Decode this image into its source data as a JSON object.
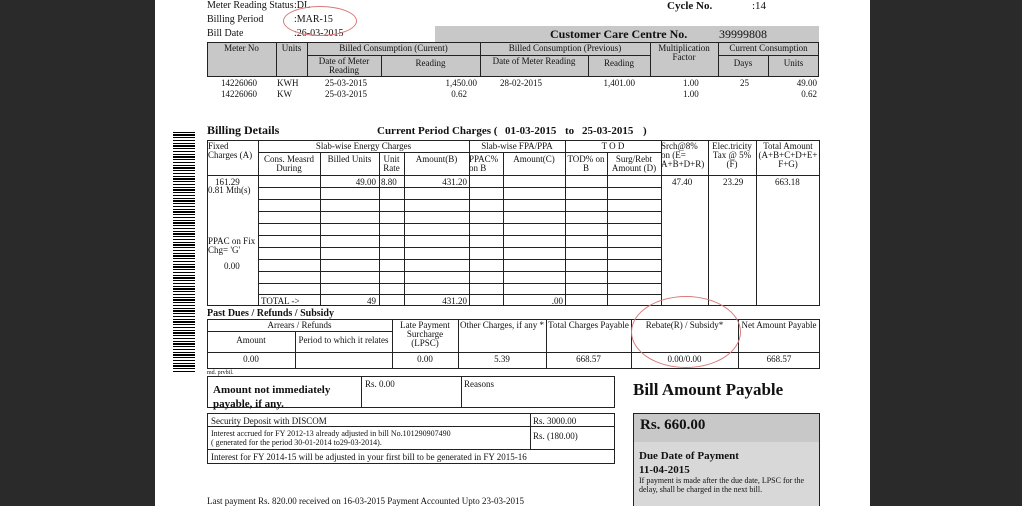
{
  "header": {
    "meter_reading_status_label": "Meter Reading Status",
    "meter_reading_status_value": ":DL",
    "billing_period_label": "Billing Period",
    "billing_period_value": ":MAR-15",
    "bill_date_label": "Bill Date",
    "bill_date_value": ":26-03-2015",
    "cycle_no_label": "Cycle No.",
    "cycle_no_value": ":14",
    "customer_care_label": "Customer Care Centre No.",
    "customer_care_value": "39999808"
  },
  "meter_table": {
    "headers": {
      "meter_no": "Meter No",
      "units": "Units",
      "billed_current": "Billed Consumption (Current)",
      "billed_previous": "Billed Consumption (Previous)",
      "multiplication_factor": "Multiplication Factor",
      "current_consumption": "Current Consumption",
      "date_of_meter_reading": "Date of Meter Reading",
      "reading": "Reading",
      "days": "Days",
      "units_sub": "Units"
    },
    "rows": [
      {
        "meter_no": "14226060",
        "units": "KWH",
        "cur_date": "25-03-2015",
        "cur_reading": "1,450.00",
        "prev_date": "28-02-2015",
        "prev_reading": "1,401.00",
        "mf": "1.00",
        "days": "25",
        "cons_units": "49.00"
      },
      {
        "meter_no": "14226060",
        "units": "KW",
        "cur_date": "25-03-2015",
        "cur_reading": "0.62",
        "prev_date": "",
        "prev_reading": "",
        "mf": "1.00",
        "days": "",
        "cons_units": "0.62"
      }
    ]
  },
  "billing": {
    "title": "Billing Details",
    "current_period_label": "Current Period Charges (",
    "from": "01-03-2015",
    "to_label": "to",
    "to": "25-03-2015",
    "close": ")",
    "headers": {
      "fixed_charges": "Fixed Charges (A)",
      "slab_energy": "Slab-wise Energy Charges",
      "cons_measured": "Cons. Measrd During",
      "billed_units": "Billed Units",
      "unit_rate": "Unit Rate",
      "amount_b": "Amount(B)",
      "slab_fpa": "Slab-wise FPA/PPA",
      "ppac_on_b": "PPAC% on B",
      "amount_c": "Amount(C)",
      "tod": "T O D",
      "tod_on_b": "TOD% on B",
      "surg_rebt": "Surg/Rebt Amount (D)",
      "srch": "Srch@8% on (E= A+B+D+R)",
      "elec_tax": "Elec.tricity Tax @ 5% (F)",
      "total_amount": "Total Amount (A+B+C+D+E+ F+G)"
    },
    "row": {
      "fixed": "161.29",
      "fixed_sub": "0.81 Mth(s)",
      "billed_units": "49.00",
      "unit_rate": "8.80",
      "amount_b": "431.20",
      "srch": "47.40",
      "elec_tax": "23.29",
      "total": "663.18"
    },
    "ppac_label": "PPAC on Fix Chg= 'G'",
    "ppac_value": "0.00",
    "total_label": "TOTAL ->",
    "total_units": "49",
    "total_amount_b": "431.20",
    "total_amount_c": ".00"
  },
  "past_dues": {
    "title": "Past Dues / Refunds / Subsidy",
    "arrears_refunds": "Arrears / Refunds",
    "amount": "Amount",
    "period": "Period to which it relates",
    "lpsc": "Late Payment Surcharge (LPSC)",
    "other_charges": "Other Charges, if any *",
    "total_charges": "Total Charges Payable",
    "rebate_subsidy": "Rebate(R) / Subsidy*",
    "net_amount": "Net Amount Payable",
    "v_amount": "0.00",
    "v_lpsc": "0.00",
    "v_other": "5.39",
    "v_total": "668.57",
    "v_rebate": "0.00/0.00",
    "v_net": "668.57"
  },
  "misc": {
    "small_note": "md. prvbil.",
    "not_immediately": "Amount not immediately payable, if any.",
    "rs_amount": "Rs. 0.00",
    "reasons": "Reasons",
    "security_deposit": "Security Deposit with DISCOM",
    "security_value": "Rs. 3000.00",
    "interest_line1": "Interest accrued for FY 2012-13 already adjusted in bill No.101290907490",
    "interest_line2": "( generated for the period 30-01-2014 to29-03-2014).",
    "interest_value": "Rs. (180.00)",
    "interest_fy": "Interest for FY 2014-15 will be adjusted in your first bill to be generated in FY 2015-16",
    "last_payment": "Last payment Rs. 820.00 received on 16-03-2015 Payment Accounted Upto 23-03-2015"
  },
  "payable": {
    "title": "Bill Amount Payable",
    "amount": "Rs. 660.00",
    "due_label": "Due Date of Payment",
    "due_date": "11-04-2015",
    "note": "If payment is made after the due date, LPSC for the delay, shall be charged in the next bill."
  }
}
